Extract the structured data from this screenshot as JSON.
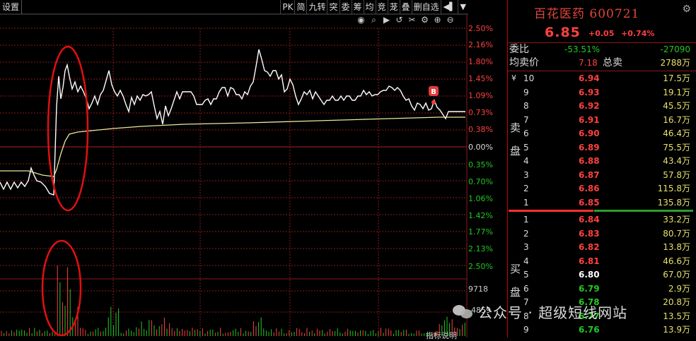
{
  "toolbar": {
    "left_label": "设置",
    "buttons": [
      "PK",
      "简",
      "九转",
      "突",
      "委",
      "筹",
      "均",
      "竞",
      "茏",
      "叠",
      "删自选"
    ],
    "arrow_label": "◀▌",
    "dropdown_label": "▼"
  },
  "chart_icons": [
    "eye-icon",
    "search-icon",
    "play-icon",
    "undo-icon",
    "scissors-icon",
    "settings-icon",
    "zoom-in-icon",
    "zoom-out-icon"
  ],
  "chart_icon_glyphs": [
    "◉",
    "⌕",
    "▶",
    "↺",
    "✂",
    "⚙",
    "⊕",
    "⊖"
  ],
  "axis": {
    "pct_up": [
      "2.50%",
      "2.16%",
      "1.80%",
      "1.45%",
      "1.09%",
      "0.73%",
      "0.38%"
    ],
    "pct_zero": "0.00%",
    "pct_down": [
      "0.35%",
      "0.70%",
      "1.06%",
      "1.42%",
      "1.77%",
      "2.13%",
      "2.50%"
    ],
    "volume_labels": [
      "9718",
      "4859"
    ],
    "bottom_label": "指标说明"
  },
  "marker": {
    "label": "B"
  },
  "colors": {
    "up": "#ff4040",
    "down": "#22c822",
    "grid": "#8b1a1a",
    "avg_line": "#e8e8a0",
    "price_line": "#ffffff",
    "annotation": "#e01010"
  },
  "stock": {
    "name": "百花医药",
    "code": "600721",
    "price": "6.85",
    "change": "+0.05",
    "change_pct": "+0.74%"
  },
  "quote": {
    "weibi_label": "委比",
    "weibi_value": "-53.51%",
    "weicha_value": "-27090",
    "avg_label": "均卖价",
    "avg_value": "7.18",
    "total_label": "总卖",
    "total_value": "2788万"
  },
  "sell_side_label": [
    "卖",
    "盘"
  ],
  "buy_side_label": [
    "买",
    "盘"
  ],
  "currency_symbol": "¥",
  "sell_orders": [
    {
      "level": "10",
      "price": "6.94",
      "volume": "17.5万"
    },
    {
      "level": "9",
      "price": "6.93",
      "volume": "19.1万"
    },
    {
      "level": "8",
      "price": "6.92",
      "volume": "45.5万"
    },
    {
      "level": "7",
      "price": "6.91",
      "volume": "16.7万"
    },
    {
      "level": "6",
      "price": "6.90",
      "volume": "46.4万"
    },
    {
      "level": "5",
      "price": "6.89",
      "volume": "75.5万"
    },
    {
      "level": "4",
      "price": "6.88",
      "volume": "43.4万"
    },
    {
      "level": "3",
      "price": "6.87",
      "volume": "57.8万"
    },
    {
      "level": "2",
      "price": "6.86",
      "volume": "115.8万"
    },
    {
      "level": "1",
      "price": "6.85",
      "volume": "135.8万"
    }
  ],
  "buy_orders": [
    {
      "level": "1",
      "price": "6.84",
      "volume": "33.2万"
    },
    {
      "level": "2",
      "price": "6.83",
      "volume": "80.7万"
    },
    {
      "level": "3",
      "price": "6.82",
      "volume": "13.8万"
    },
    {
      "level": "4",
      "price": "6.81",
      "volume": "46.6万"
    },
    {
      "level": "5",
      "price": "6.80",
      "volume": "67.0万"
    },
    {
      "level": "6",
      "price": "6.79",
      "volume": "2.9万"
    },
    {
      "level": "7",
      "price": "6.78",
      "volume": "20.8万"
    },
    {
      "level": "8",
      "price": "6.77",
      "volume": "13.5万"
    },
    {
      "level": "9",
      "price": "6.76",
      "volume": "13.9万"
    }
  ],
  "buy_price_colors": [
    "#ff4040",
    "#ff4040",
    "#ff4040",
    "#ff4040",
    "#ffffff",
    "#22c822",
    "#22c822",
    "#22c822",
    "#22c822"
  ],
  "watermark": "公众号 · 超级短线网站"
}
